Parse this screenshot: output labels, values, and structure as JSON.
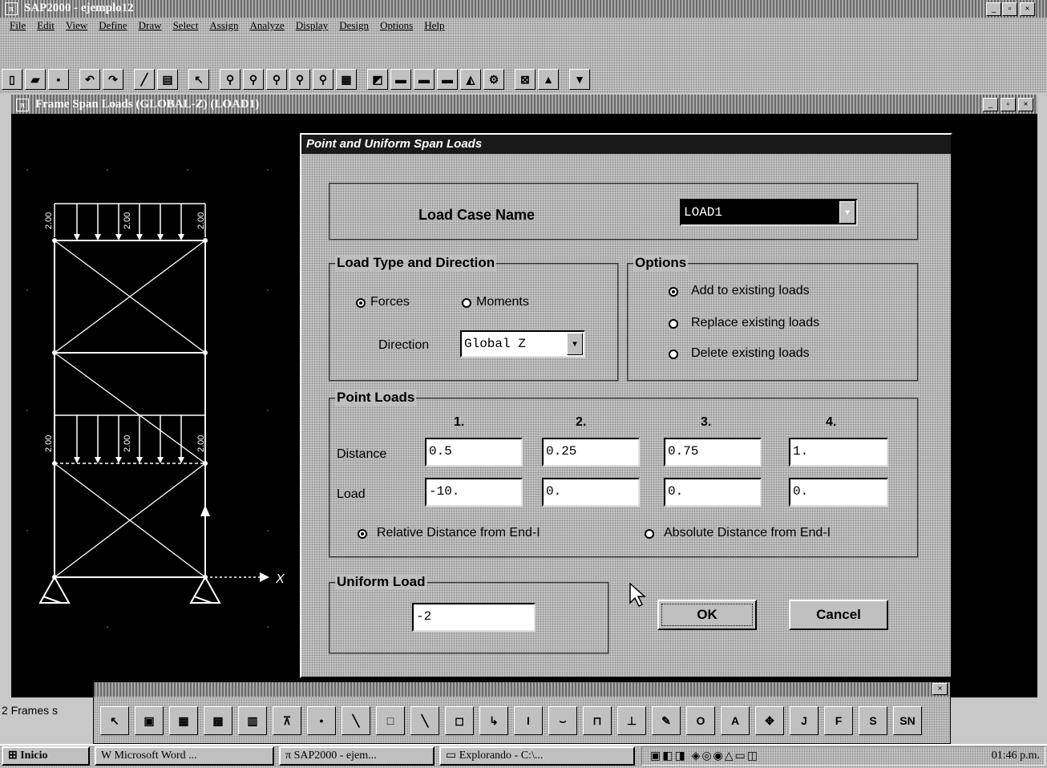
{
  "app": {
    "title": "SAP2000 - ejemplo12"
  },
  "menu": [
    "File",
    "Edit",
    "View",
    "Define",
    "Draw",
    "Select",
    "Assign",
    "Analyze",
    "Display",
    "Design",
    "Options",
    "Help"
  ],
  "toolbar_icons": [
    "new-file-icon",
    "open-folder-icon",
    "save-icon",
    "undo-icon",
    "redo-icon",
    "pencil-icon",
    "print-icon",
    "pointer-icon",
    "zoom-window-icon",
    "zoom-in-icon",
    "zoom-out-icon",
    "zoom-full-icon",
    "zoom-previous-icon",
    "refresh-icon",
    "3d-view-icon",
    "xy-view-icon",
    "xz-view-icon",
    "yz-view-icon",
    "perspective-icon",
    "set-elements-icon",
    "shrink-icon",
    "up-icon",
    "down-icon"
  ],
  "subwindow": {
    "title": "Frame Span Loads (GLOBAL-Z) (LOAD1)"
  },
  "model": {
    "load_labels_top": [
      "2.00",
      "2.00",
      "2.00"
    ],
    "load_labels_mid": [
      "2.00",
      "2.00",
      "2.00"
    ],
    "axis_x": "X"
  },
  "dialog": {
    "title": "Point and Uniform Span Loads",
    "load_case_label": "Load Case Name",
    "load_case_value": "LOAD1",
    "load_type": {
      "legend": "Load Type and Direction",
      "forces": "Forces",
      "moments": "Moments",
      "selected": "forces",
      "direction_label": "Direction",
      "direction_value": "Global Z"
    },
    "options": {
      "legend": "Options",
      "add": "Add to existing loads",
      "replace": "Replace existing loads",
      "delete": "Delete existing loads",
      "selected": "add"
    },
    "point_loads": {
      "legend": "Point Loads",
      "columns": [
        "1.",
        "2.",
        "3.",
        "4."
      ],
      "distance_label": "Distance",
      "load_label": "Load",
      "distances": [
        "0.5",
        "0.25",
        "0.75",
        "1."
      ],
      "loads": [
        "-10.",
        "0.",
        "0.",
        "0."
      ],
      "relative": "Relative Distance from End-I",
      "absolute": "Absolute Distance from End-I",
      "selected": "relative"
    },
    "uniform": {
      "legend": "Uniform Load",
      "value": "-2"
    },
    "ok": "OK",
    "cancel": "Cancel"
  },
  "status": {
    "text": "2 Frames s"
  },
  "draw_toolbar_icons": [
    "pointer-icon",
    "draw-frame-icon",
    "draw-shell-icon",
    "quick-shell-icon",
    "quick-frame-icon",
    "joint-restraint-icon",
    "joint-icon",
    "frame-line-icon",
    "rectangle-icon",
    "line-icon",
    "area-icon",
    "arrow-icon",
    "text-icon",
    "curve-icon",
    "member-icon",
    "support-icon",
    "edit-icon",
    "circle-icon",
    "analyze-icon",
    "design-icon",
    "j-icon",
    "f-icon",
    "s-icon",
    "sn-icon"
  ],
  "draw_toolbar_labels": [
    "O",
    "A",
    "J",
    "F",
    "S"
  ],
  "taskbar": {
    "start": "Inicio",
    "items": [
      "Microsoft Word ...",
      "SAP2000 - ejem...",
      "Explorando - C:\\..."
    ],
    "clock": "01:46 p.m."
  }
}
